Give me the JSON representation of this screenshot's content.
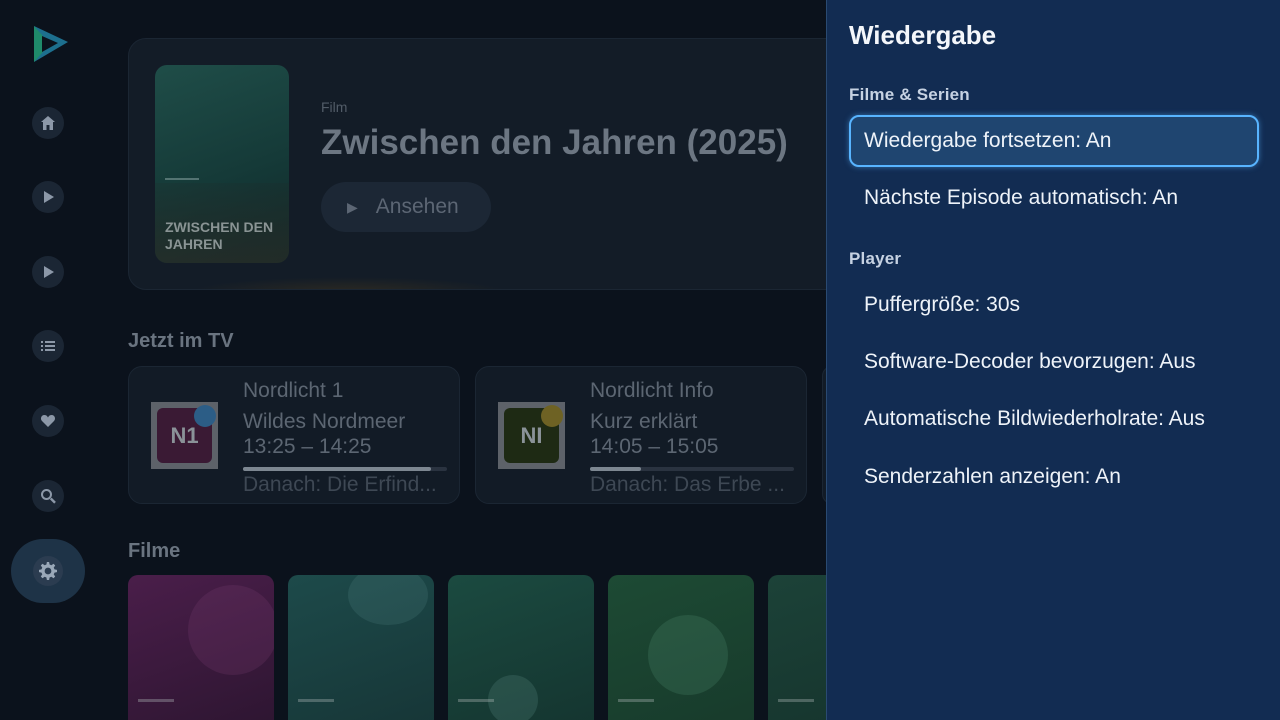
{
  "colors": {
    "background": "#0b121c",
    "panel": "#122c52",
    "focus_accent": "#58b4ff",
    "logo_accent": "#2a9ad6"
  },
  "sidebar": {
    "items": [
      {
        "icon": "home-icon"
      },
      {
        "icon": "play-icon"
      },
      {
        "icon": "play-icon"
      },
      {
        "icon": "list-icon"
      },
      {
        "icon": "heart-icon"
      },
      {
        "icon": "search-icon"
      },
      {
        "icon": "gear-icon",
        "active": true
      }
    ]
  },
  "hero": {
    "poster_title": "ZWISCHEN DEN JAHREN",
    "kind": "Film",
    "title": "Zwischen den Jahren (2025)",
    "watch_label": "Ansehen"
  },
  "sections": {
    "tv": "Jetzt im TV",
    "movies": "Filme"
  },
  "tv_cards": [
    {
      "logo_text": "N1",
      "channel": "Nordlicht 1",
      "show": "Wildes Nordmeer",
      "time": "13:25 – 14:25",
      "progress": 0.92,
      "next": "Danach: Die Erfind..."
    },
    {
      "logo_text": "NI",
      "channel": "Nordlicht Info",
      "show": "Kurz erklärt",
      "time": "14:05 – 15:05",
      "progress": 0.25,
      "next": "Danach: Das Erbe ..."
    }
  ],
  "settings": {
    "title": "Wiedergabe",
    "groups": [
      {
        "title": "Filme & Serien",
        "options": [
          {
            "label": "Wiedergabe fortsetzen: An",
            "focused": true
          },
          {
            "label": "Nächste Episode automatisch: An"
          }
        ]
      },
      {
        "title": "Player",
        "options": [
          {
            "label": "Puffergröße: 30s"
          },
          {
            "label": "Software-Decoder bevorzugen: Aus"
          },
          {
            "label": "Automatische Bildwiederholrate: Aus"
          },
          {
            "label": "Senderzahlen anzeigen: An"
          }
        ]
      }
    ]
  }
}
